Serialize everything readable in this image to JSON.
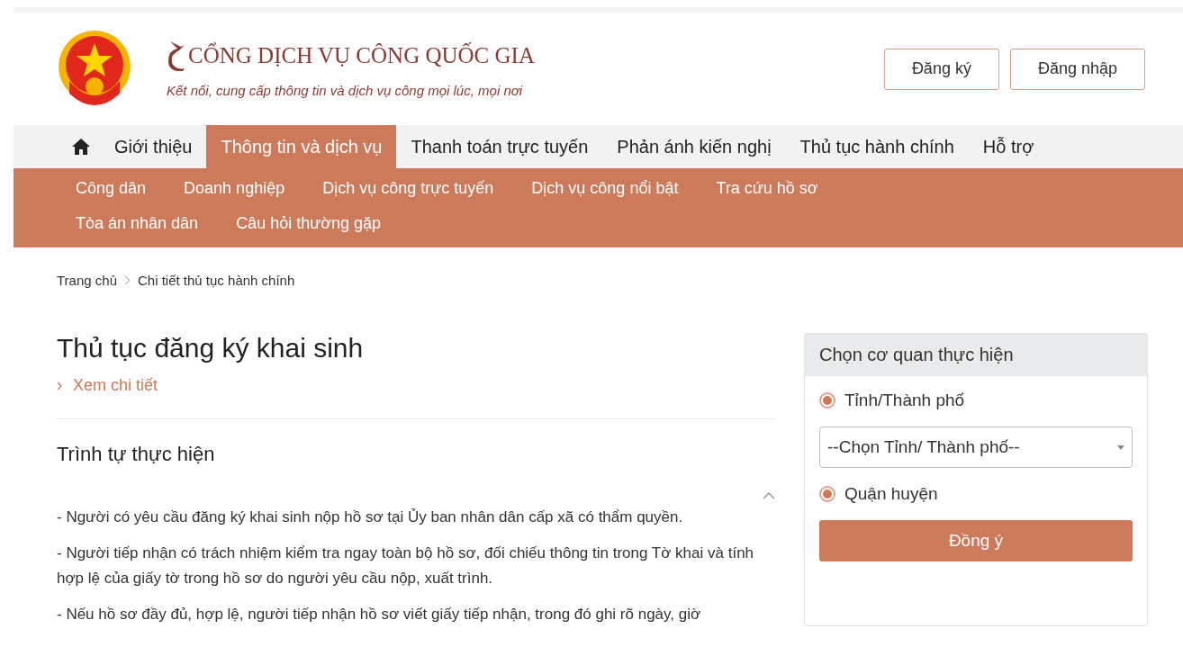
{
  "header": {
    "title": "CỔNG DỊCH VỤ CÔNG QUỐC GIA",
    "tagline": "Kết nối, cung cấp thông tin và dịch vụ công mọi lúc, mọi nơi",
    "buttons": [
      "Đăng ký",
      "Đăng nhập"
    ]
  },
  "nav": [
    {
      "label": "Giới thiệu",
      "selected": false
    },
    {
      "label": "Thông tin và dịch vụ",
      "selected": true
    },
    {
      "label": "Thanh toán trực tuyến",
      "selected": false
    },
    {
      "label": "Phản ánh kiến nghị",
      "selected": false
    },
    {
      "label": "Thủ tục hành chính",
      "selected": false
    },
    {
      "label": "Hỗ trợ",
      "selected": false
    }
  ],
  "subnav": [
    "Công dân",
    "Doanh nghiệp",
    "Dịch vụ công trực tuyến",
    "Dịch vụ công nổi bật",
    "Tra cứu hồ sơ",
    "Tòa án nhân dân",
    "Câu hỏi thường gặp"
  ],
  "breadcrumb": [
    "Trang chủ",
    "Chi tiết thủ tục hành chính"
  ],
  "procedure": {
    "title": "Thủ tục đăng ký khai sinh",
    "detail_link": "Xem chi tiết",
    "section_title": "Trình tự thực hiện",
    "expanded": true,
    "paragraphs": [
      "- Người có yêu cầu đăng ký khai sinh nộp hồ sơ tại Ủy ban nhân dân cấp xã có thẩm quyền.",
      "- Người tiếp nhận có trách nhiệm kiểm tra ngay toàn bộ hồ sơ, đối chiếu thông tin trong Tờ khai và tính hợp lệ của giấy tờ trong hồ sơ do người yêu cầu nộp, xuất trình.",
      "- Nếu hồ sơ đầy đủ, hợp lệ, người tiếp nhận hồ sơ viết giấy tiếp nhận, trong đó ghi rõ ngày, giờ"
    ]
  },
  "agency_panel": {
    "title": "Chọn cơ quan thực hiện",
    "options": [
      {
        "kind": "radio",
        "label": "Tỉnh/Thành phố",
        "selected": true
      },
      {
        "kind": "select",
        "placeholder": "--Chọn Tỉnh/ Thành phố--"
      },
      {
        "kind": "radio",
        "label": "Quận huyện",
        "selected": true
      }
    ],
    "submit": "Đồng ý"
  }
}
